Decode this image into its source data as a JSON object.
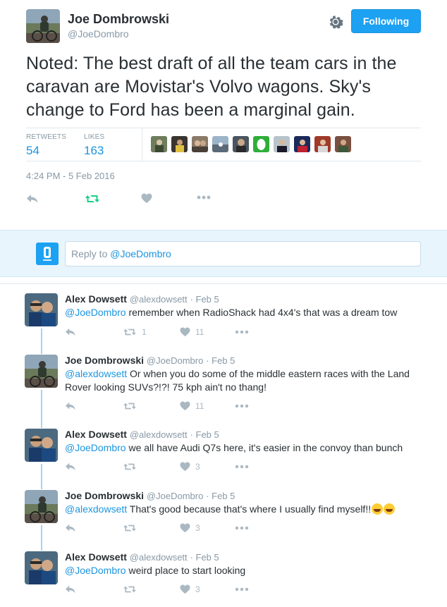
{
  "tweet": {
    "author_name": "Joe Dombrowski",
    "author_handle": "@JoeDombro",
    "follow_label": "Following",
    "text": "Noted: The best draft of all the team cars in the caravan are Movistar's Volvo wagons. Sky's change to Ford has been a marginal gain.",
    "retweets_label": "RETWEETS",
    "retweets": "54",
    "likes_label": "LIKES",
    "likes": "163",
    "timestamp": "4:24 PM - 5 Feb 2016",
    "liker_count": 10
  },
  "reply_box": {
    "prefix": "Reply to ",
    "mention": "@JoeDombro"
  },
  "replies": [
    {
      "name": "Alex Dowsett",
      "handle": "@alexdowsett",
      "date": "Feb 5",
      "mention": "@JoeDombro",
      "text": " remember when RadioShack had 4x4's that was a dream tow",
      "retweets": "1",
      "likes": "11"
    },
    {
      "name": "Joe Dombrowski",
      "handle": "@JoeDombro",
      "date": "Feb 5",
      "mention": "@alexdowsett",
      "text": " Or when you do some of the middle eastern races with the Land Rover looking SUVs?!?! 75 kph ain't no thang!",
      "retweets": "",
      "likes": "11"
    },
    {
      "name": "Alex Dowsett",
      "handle": "@alexdowsett",
      "date": "Feb 5",
      "mention": "@JoeDombro",
      "text": " we all have Audi Q7s here, it's easier in the convoy than bunch",
      "retweets": "",
      "likes": "3"
    },
    {
      "name": "Joe Dombrowski",
      "handle": "@JoeDombro",
      "date": "Feb 5",
      "mention": "@alexdowsett",
      "text": " That's good because that's where I usually find myself!!",
      "retweets": "",
      "likes": "3"
    },
    {
      "name": "Alex Dowsett",
      "handle": "@alexdowsett",
      "date": "Feb 5",
      "mention": "@JoeDombro",
      "text": " weird place to start looking",
      "retweets": "",
      "likes": "3"
    }
  ],
  "icons": {
    "reply": "reply-icon",
    "retweet": "retweet-icon",
    "like": "heart-icon",
    "more": "more-dots-icon",
    "settings": "gear-icon",
    "emoji": "tears-of-joy-emoji"
  },
  "colors": {
    "accent": "#1da1f2",
    "link": "#1b95e0",
    "retweet_active": "#19cf86",
    "muted": "#aab8c2"
  }
}
